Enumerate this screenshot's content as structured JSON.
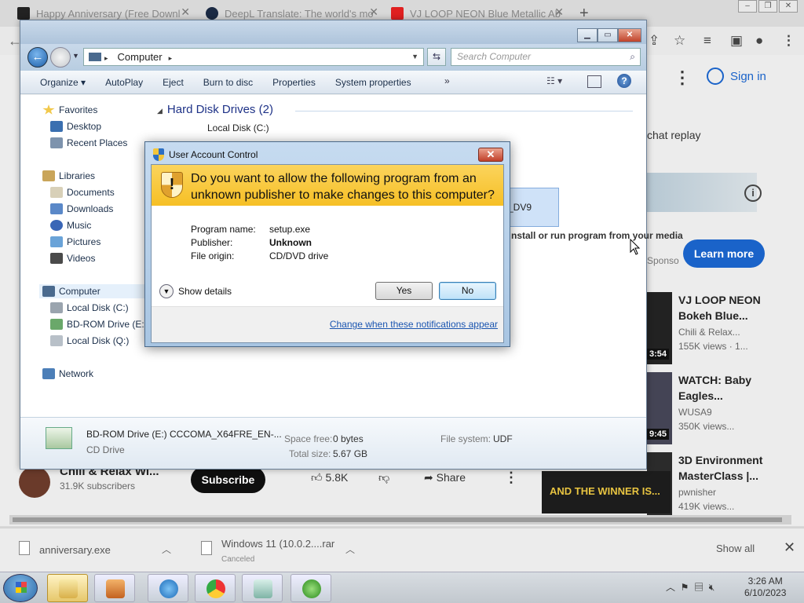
{
  "browser": {
    "tabs": [
      {
        "label": "Happy Anniversary (Free Downl",
        "color": "#222222"
      },
      {
        "label": "DeepL Translate: The world's mo",
        "color": "#1b2a44"
      },
      {
        "label": "VJ LOOP NEON Blue Metallic Ab",
        "color": "#e02020"
      }
    ],
    "new_tab_symbol": "+"
  },
  "youtube": {
    "sign_in": "Sign in",
    "chat_replay": "chat replay",
    "learn_more": "Learn more",
    "sponsored": "Sponso",
    "videos": [
      {
        "title": "VJ LOOP NEON Bokeh Blue...",
        "channel": "Chili & Relax...",
        "views": "155K views · 1...",
        "duration": "3:54"
      },
      {
        "title": "WATCH: Baby Eagles...",
        "channel": "WUSA9",
        "views": "350K views...",
        "duration": "9:45"
      },
      {
        "title": "3D Environment MasterClass |...",
        "channel": "pwnisher",
        "views": "419K views...",
        "duration": ""
      }
    ],
    "channel_name": "Chili & Relax Wi...",
    "subscribers": "31.9K subscribers",
    "subscribe": "Subscribe",
    "likes": "5.8K",
    "share": "Share",
    "winner_thumb_text": "AND THE WINNER IS..."
  },
  "downloads": {
    "items": [
      {
        "name": "anniversary.exe",
        "status": ""
      },
      {
        "name": "Windows 11 (10.0.2....rar",
        "status": "Canceled"
      }
    ],
    "show_all": "Show all"
  },
  "explorer": {
    "path": "Computer",
    "search_placeholder": "Search Computer",
    "commands": [
      "Organize ▾",
      "AutoPlay",
      "Eject",
      "Burn to disc",
      "Properties",
      "System properties"
    ],
    "more": "»",
    "nav": {
      "favorites": "Favorites",
      "desktop": "Desktop",
      "recent": "Recent Places",
      "libraries": "Libraries",
      "documents": "Documents",
      "downloads": "Downloads",
      "music": "Music",
      "pictures": "Pictures",
      "videos": "Videos",
      "computer": "Computer",
      "local_c": "Local Disk (C:)",
      "bd_rom": "BD-ROM Drive (E:)",
      "local_q": "Local Disk (Q:)",
      "network": "Network"
    },
    "main": {
      "hdd_heading": "Hard Disk Drives (2)",
      "local_c": "Local Disk (C:)",
      "dvd_label": "_DV9",
      "autorun_text": "nstall or run program from your media"
    },
    "details": {
      "name": "BD-ROM Drive (E:) CCCOMA_X64FRE_EN-...",
      "type": "CD Drive",
      "space_free_label": "Space free:",
      "space_free_value": "0 bytes",
      "total_size_label": "Total size:",
      "total_size_value": "5.67 GB",
      "file_system_label": "File system:",
      "file_system_value": "UDF"
    }
  },
  "uac": {
    "title": "User Account Control",
    "question": "Do you want to allow the following program from an unknown publisher to make changes to this computer?",
    "fields": [
      {
        "label": "Program name:",
        "value": "setup.exe",
        "bold": false
      },
      {
        "label": "Publisher:",
        "value": "Unknown",
        "bold": true
      },
      {
        "label": "File origin:",
        "value": "CD/DVD drive",
        "bold": false
      }
    ],
    "show_details": "Show details",
    "yes": "Yes",
    "no": "No",
    "link": "Change when these notifications appear",
    "banner_color": "#f6bf25"
  },
  "taskbar": {
    "time": "3:26 AM",
    "date": "6/10/2023"
  }
}
